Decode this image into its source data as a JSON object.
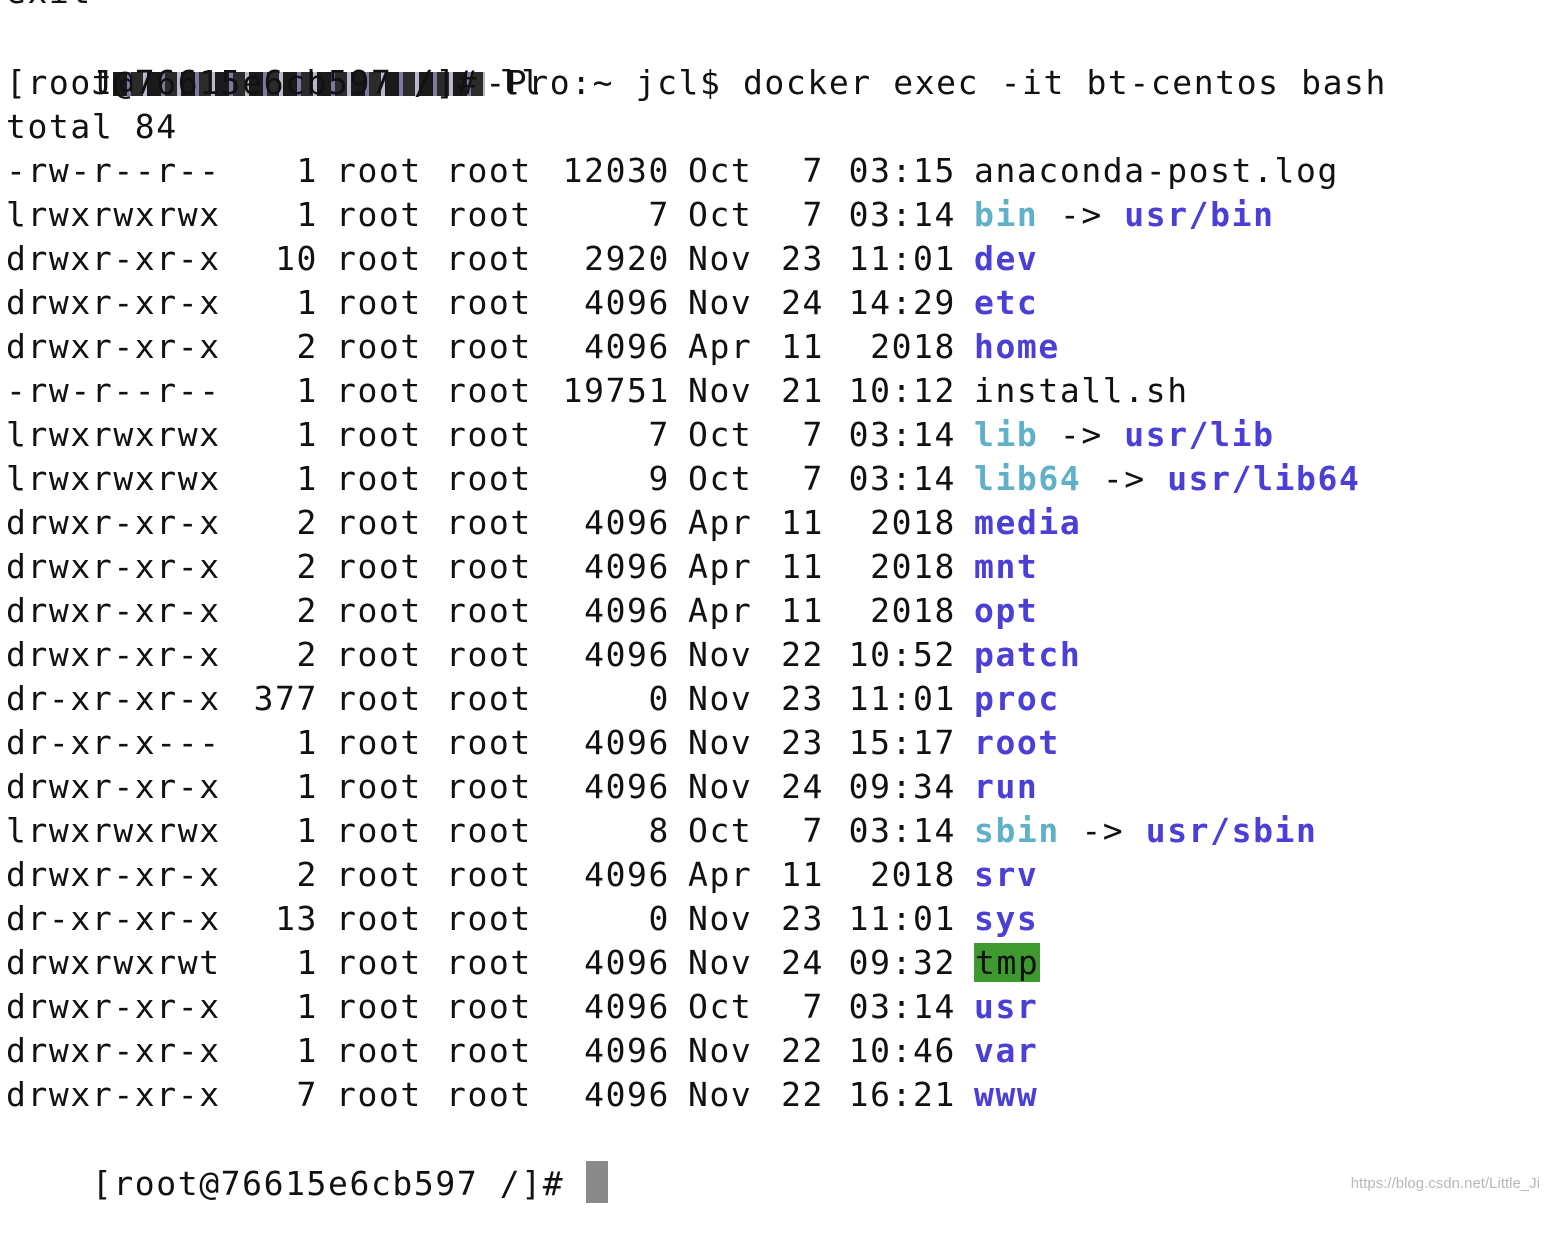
{
  "partial_top_text": "exit",
  "command_line": {
    "prefix": "J",
    "host_suffix": "-Pro:~ jcl$ docker exec -it bt-centos bash"
  },
  "prompt_1": "[root@76615e6cb597 /]# ll",
  "total_line": "total 84",
  "listing": [
    {
      "perms": "-rw-r--r--",
      "links": "1",
      "owner": "root",
      "group": "root",
      "size": "12030",
      "month": "Oct",
      "day": "7",
      "time": "03:15",
      "name": "anaconda-post.log",
      "type": "file",
      "target": ""
    },
    {
      "perms": "lrwxrwxrwx",
      "links": "1",
      "owner": "root",
      "group": "root",
      "size": "7",
      "month": "Oct",
      "day": "7",
      "time": "03:14",
      "name": "bin",
      "type": "link",
      "target": "usr/bin"
    },
    {
      "perms": "drwxr-xr-x",
      "links": "10",
      "owner": "root",
      "group": "root",
      "size": "2920",
      "month": "Nov",
      "day": "23",
      "time": "11:01",
      "name": "dev",
      "type": "dir",
      "target": ""
    },
    {
      "perms": "drwxr-xr-x",
      "links": "1",
      "owner": "root",
      "group": "root",
      "size": "4096",
      "month": "Nov",
      "day": "24",
      "time": "14:29",
      "name": "etc",
      "type": "dir",
      "target": ""
    },
    {
      "perms": "drwxr-xr-x",
      "links": "2",
      "owner": "root",
      "group": "root",
      "size": "4096",
      "month": "Apr",
      "day": "11",
      "time": "2018",
      "name": "home",
      "type": "dir",
      "target": ""
    },
    {
      "perms": "-rw-r--r--",
      "links": "1",
      "owner": "root",
      "group": "root",
      "size": "19751",
      "month": "Nov",
      "day": "21",
      "time": "10:12",
      "name": "install.sh",
      "type": "file",
      "target": ""
    },
    {
      "perms": "lrwxrwxrwx",
      "links": "1",
      "owner": "root",
      "group": "root",
      "size": "7",
      "month": "Oct",
      "day": "7",
      "time": "03:14",
      "name": "lib",
      "type": "link",
      "target": "usr/lib"
    },
    {
      "perms": "lrwxrwxrwx",
      "links": "1",
      "owner": "root",
      "group": "root",
      "size": "9",
      "month": "Oct",
      "day": "7",
      "time": "03:14",
      "name": "lib64",
      "type": "link",
      "target": "usr/lib64"
    },
    {
      "perms": "drwxr-xr-x",
      "links": "2",
      "owner": "root",
      "group": "root",
      "size": "4096",
      "month": "Apr",
      "day": "11",
      "time": "2018",
      "name": "media",
      "type": "dir",
      "target": ""
    },
    {
      "perms": "drwxr-xr-x",
      "links": "2",
      "owner": "root",
      "group": "root",
      "size": "4096",
      "month": "Apr",
      "day": "11",
      "time": "2018",
      "name": "mnt",
      "type": "dir",
      "target": ""
    },
    {
      "perms": "drwxr-xr-x",
      "links": "2",
      "owner": "root",
      "group": "root",
      "size": "4096",
      "month": "Apr",
      "day": "11",
      "time": "2018",
      "name": "opt",
      "type": "dir",
      "target": ""
    },
    {
      "perms": "drwxr-xr-x",
      "links": "2",
      "owner": "root",
      "group": "root",
      "size": "4096",
      "month": "Nov",
      "day": "22",
      "time": "10:52",
      "name": "patch",
      "type": "dir",
      "target": ""
    },
    {
      "perms": "dr-xr-xr-x",
      "links": "377",
      "owner": "root",
      "group": "root",
      "size": "0",
      "month": "Nov",
      "day": "23",
      "time": "11:01",
      "name": "proc",
      "type": "dir",
      "target": ""
    },
    {
      "perms": "dr-xr-x---",
      "links": "1",
      "owner": "root",
      "group": "root",
      "size": "4096",
      "month": "Nov",
      "day": "23",
      "time": "15:17",
      "name": "root",
      "type": "dir",
      "target": ""
    },
    {
      "perms": "drwxr-xr-x",
      "links": "1",
      "owner": "root",
      "group": "root",
      "size": "4096",
      "month": "Nov",
      "day": "24",
      "time": "09:34",
      "name": "run",
      "type": "dir",
      "target": ""
    },
    {
      "perms": "lrwxrwxrwx",
      "links": "1",
      "owner": "root",
      "group": "root",
      "size": "8",
      "month": "Oct",
      "day": "7",
      "time": "03:14",
      "name": "sbin",
      "type": "link",
      "target": "usr/sbin"
    },
    {
      "perms": "drwxr-xr-x",
      "links": "2",
      "owner": "root",
      "group": "root",
      "size": "4096",
      "month": "Apr",
      "day": "11",
      "time": "2018",
      "name": "srv",
      "type": "dir",
      "target": ""
    },
    {
      "perms": "dr-xr-xr-x",
      "links": "13",
      "owner": "root",
      "group": "root",
      "size": "0",
      "month": "Nov",
      "day": "23",
      "time": "11:01",
      "name": "sys",
      "type": "dir",
      "target": ""
    },
    {
      "perms": "drwxrwxrwt",
      "links": "1",
      "owner": "root",
      "group": "root",
      "size": "4096",
      "month": "Nov",
      "day": "24",
      "time": "09:32",
      "name": "tmp",
      "type": "sticky",
      "target": ""
    },
    {
      "perms": "drwxr-xr-x",
      "links": "1",
      "owner": "root",
      "group": "root",
      "size": "4096",
      "month": "Oct",
      "day": "7",
      "time": "03:14",
      "name": "usr",
      "type": "dir",
      "target": ""
    },
    {
      "perms": "drwxr-xr-x",
      "links": "1",
      "owner": "root",
      "group": "root",
      "size": "4096",
      "month": "Nov",
      "day": "22",
      "time": "10:46",
      "name": "var",
      "type": "dir",
      "target": ""
    },
    {
      "perms": "drwxr-xr-x",
      "links": "7",
      "owner": "root",
      "group": "root",
      "size": "4096",
      "month": "Nov",
      "day": "22",
      "time": "16:21",
      "name": "www",
      "type": "dir",
      "target": ""
    }
  ],
  "arrow": "->",
  "prompt_2": "[root@76615e6cb597 /]# ",
  "watermark": "https://blog.csdn.net/Little_Ji",
  "colors": {
    "directory": "#4b3fd6",
    "symlink": "#5fb0c8",
    "sticky_background": "#3e9a2e",
    "cursor": "#8a8a8a"
  }
}
